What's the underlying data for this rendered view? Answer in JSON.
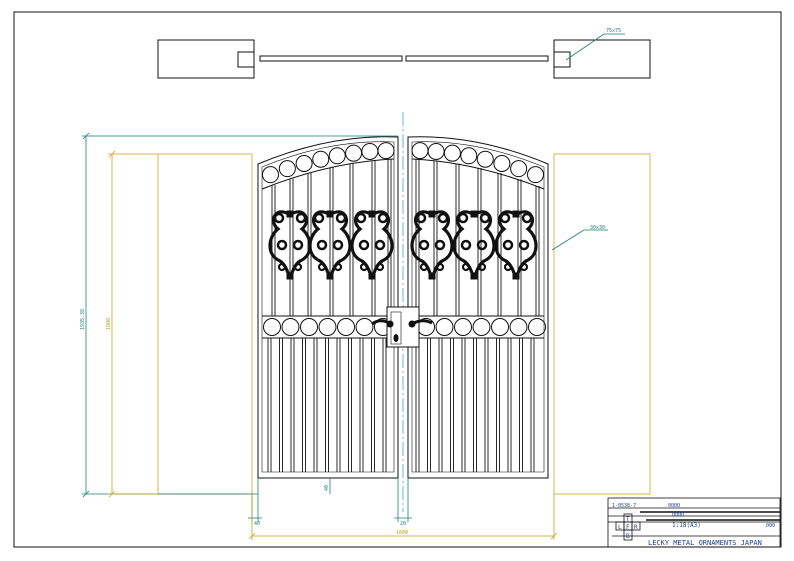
{
  "drawing": {
    "plan_view": {
      "post_size_label": "75x75"
    },
    "elevation": {
      "pillar_size_label": "30x30"
    },
    "dimensions": {
      "overall_height_label": "1935.38",
      "pillar_height_label": "1800",
      "ground_gap_label": "40",
      "left_gap_label": "40",
      "center_gap_label": "20",
      "width_label": "1600"
    },
    "title_block": {
      "drawing_no": "1-0538-7",
      "row1_value": "0000",
      "row2_value": "0000",
      "scale_label": "1:18(A3)",
      "row3_tail": "000",
      "grid_letters": [
        "T",
        "L",
        "F",
        "R",
        "B"
      ],
      "company": "LECKY METAL ORNAMENTS JAPAN"
    }
  },
  "colors": {
    "line": "#111111",
    "teal_dim": "#1a7f7a",
    "gold_dim": "#c9a21a",
    "title_text": "#1d3f8f"
  }
}
